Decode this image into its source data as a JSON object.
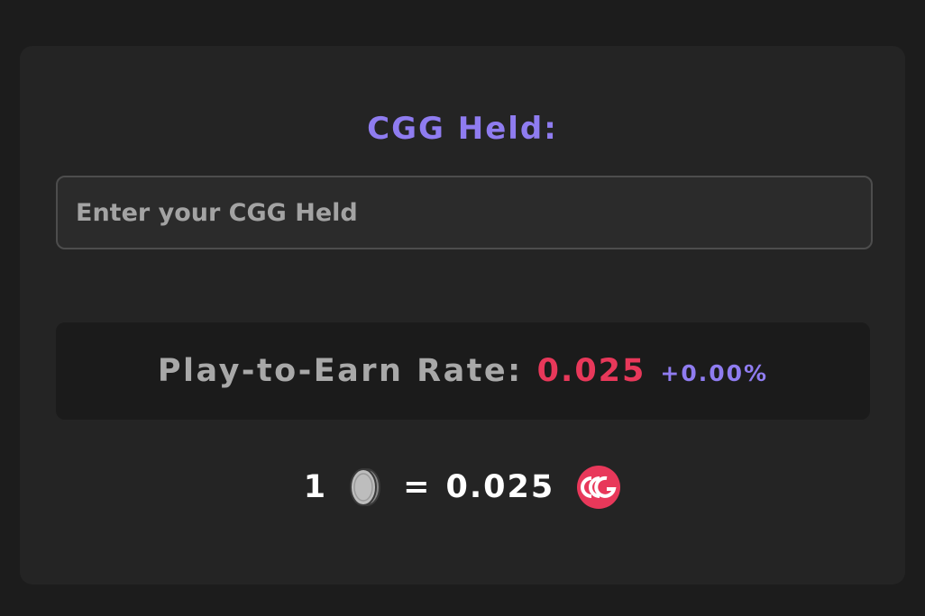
{
  "held": {
    "label": "CGG Held:",
    "placeholder": "Enter your CGG Held",
    "value": ""
  },
  "rate": {
    "label": "Play-to-Earn Rate:",
    "value": "0.025",
    "change": "+0.00%"
  },
  "conversion": {
    "left_amount": "1",
    "left_icon": "coin-icon",
    "equals": "=",
    "right_amount": "0.025",
    "right_icon": "cgg-logo-icon"
  },
  "colors": {
    "accent_purple": "#8f7cf0",
    "accent_red": "#e8385a",
    "background": "#1c1c1c",
    "card": "#242424"
  }
}
